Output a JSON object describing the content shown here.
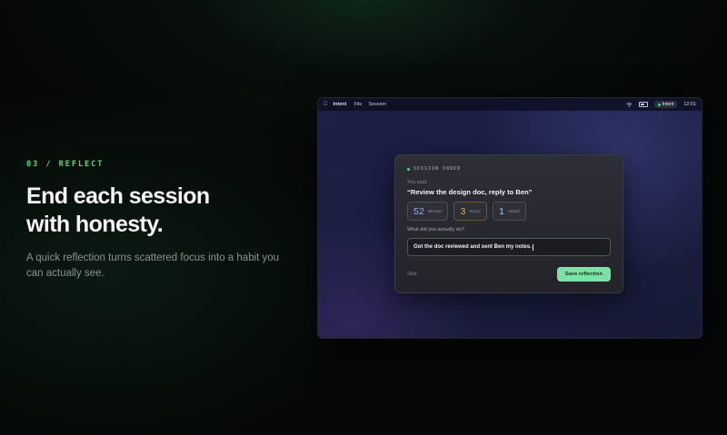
{
  "section": {
    "eyebrow": "03 / REFLECT",
    "headline_line1": "End each session",
    "headline_line2": "with honesty.",
    "subtext": "A quick reflection turns scattered focus into a habit you can actually see."
  },
  "menubar": {
    "app_name": "Intent",
    "menus": [
      "File",
      "Session"
    ],
    "status_badge": "Intent",
    "clock": "12:01",
    "icons": [
      "apple-icon",
      "wifi-icon",
      "battery-icon"
    ]
  },
  "session_card": {
    "eyebrow": "SESSION ENDED",
    "you_said_label": "You said:",
    "intent_quote": "“Review the design doc, reply to Ben”",
    "stats": [
      {
        "value": "52",
        "label": "Minutes"
      },
      {
        "value": "3",
        "label": "Strays"
      },
      {
        "value": "1",
        "label": "Added"
      }
    ],
    "question": "What did you actually do?",
    "answer_value": "Got the doc reviewed and sent Ben my notes.",
    "skip_label": "Skip",
    "save_label": "Save reflection"
  },
  "colors": {
    "accent_green": "#4ade80",
    "save_button": "#7ee0a6",
    "minutes": "#8fb4ff",
    "strays": "#f5a54a"
  }
}
